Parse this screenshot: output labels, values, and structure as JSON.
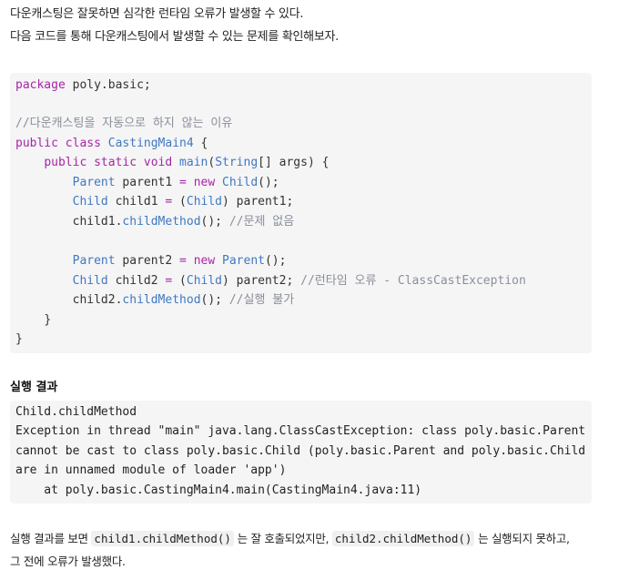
{
  "intro": {
    "line1": "다운캐스팅은 잘못하면 심각한 런타임 오류가 발생할 수 있다.",
    "line2": "다음 코드를 통해 다운캐스팅에서 발생할 수 있는 문제를 확인해보자."
  },
  "code": {
    "l1": [
      "package",
      "poly.basic;"
    ],
    "l3": "//다운캐스팅을 자동으로 하지 않는 이유",
    "l4": [
      "public",
      "class",
      "CastingMain4",
      "{"
    ],
    "l5": [
      "public",
      "static",
      "void",
      "main",
      "(",
      "String",
      "[] args) {"
    ],
    "l6": [
      "Parent",
      "parent1",
      "=",
      "new",
      "Child",
      "();"
    ],
    "l7": [
      "Child",
      "child1",
      "=",
      "(",
      "Child",
      ") parent1;"
    ],
    "l8": [
      "child1.",
      "childMethod",
      "();",
      "//문제 없음"
    ],
    "l10": [
      "Parent",
      "parent2",
      "=",
      "new",
      "Parent",
      "();"
    ],
    "l11": [
      "Child",
      "child2",
      "=",
      "(",
      "Child",
      ") parent2;",
      "//런타임 오류 - ClassCastException"
    ],
    "l12": [
      "child2.",
      "childMethod",
      "();",
      "//실행 불가"
    ],
    "l13": "}",
    "l14": "}"
  },
  "result": {
    "heading": "실행 결과",
    "lines": [
      "Child.childMethod",
      "Exception in thread \"main\" java.lang.ClassCastException: class poly.basic.Parent",
      "cannot be cast to class poly.basic.Child (poly.basic.Parent and poly.basic.Child",
      "are in unnamed module of loader 'app')",
      "    at poly.basic.CastingMain4.main(CastingMain4.java:11)"
    ]
  },
  "conclusion": {
    "part1": "실행 결과를 보면 ",
    "code1": "child1.childMethod()",
    "part2": " 는 잘 호출되었지만, ",
    "code2": "child2.childMethod()",
    "part3": " 는 실행되지 못하고,",
    "line2": "그 전에 오류가 발생했다."
  }
}
